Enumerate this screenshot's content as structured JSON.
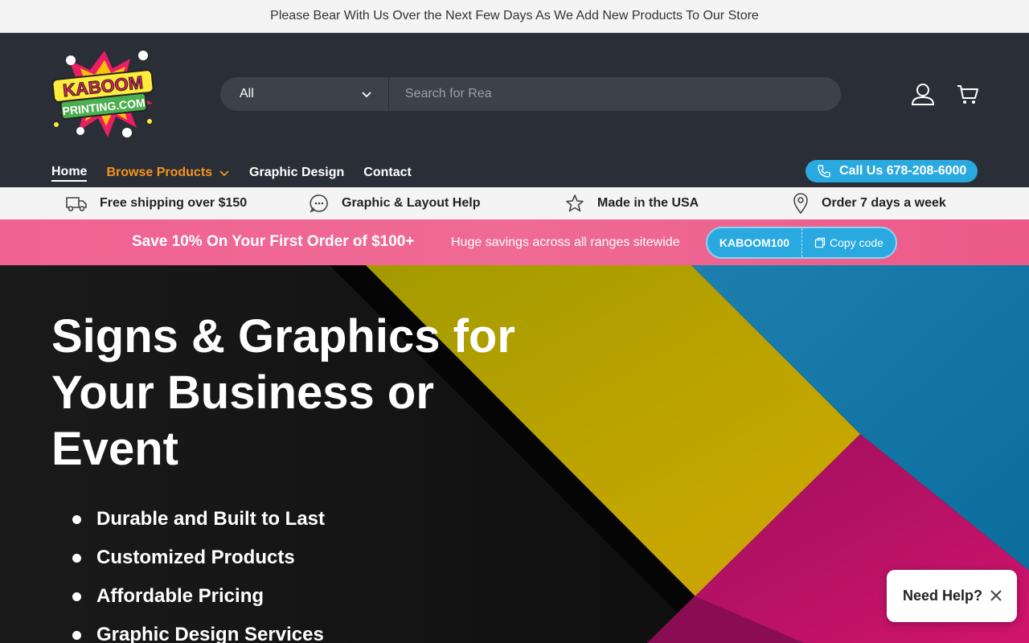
{
  "announcement": "Please Bear With Us Over the Next Few Days As We Add New Products To Our Store",
  "logo": {
    "line1": "KABOOM",
    "line2": "PRINTING.COM"
  },
  "search": {
    "category": "All",
    "placeholder": "Search for Rea"
  },
  "header_icons": [
    "user-icon",
    "cart-icon"
  ],
  "nav": {
    "items": [
      {
        "label": "Home"
      },
      {
        "label": "Browse Products"
      },
      {
        "label": "Graphic Design"
      },
      {
        "label": "Contact"
      }
    ],
    "call_label": "Call Us 678-208-6000"
  },
  "features": [
    {
      "icon": "truck-icon",
      "label": "Free shipping over $150"
    },
    {
      "icon": "chat-icon",
      "label": "Graphic & Layout Help"
    },
    {
      "icon": "star-icon",
      "label": "Made in the USA"
    },
    {
      "icon": "location-pin-icon",
      "label": "Order 7 days a week"
    }
  ],
  "promo": {
    "title": "Save 10% On Your First Order of $100+",
    "subtitle": "Huge savings across all ranges sitewide",
    "code": "KABOOM100",
    "copy_label": "Copy code"
  },
  "hero": {
    "title": "Signs & Graphics for Your Business or Event",
    "bullets": [
      "Durable and Built to Last",
      "Customized Products",
      "Affordable Pricing",
      "Graphic Design Services"
    ]
  },
  "help_widget": {
    "label": "Need Help?"
  },
  "colors": {
    "header_bg": "#2a2e37",
    "accent_orange": "#f7941d",
    "accent_blue": "#2aa9e0",
    "promo_pink": "#ef6a95"
  }
}
